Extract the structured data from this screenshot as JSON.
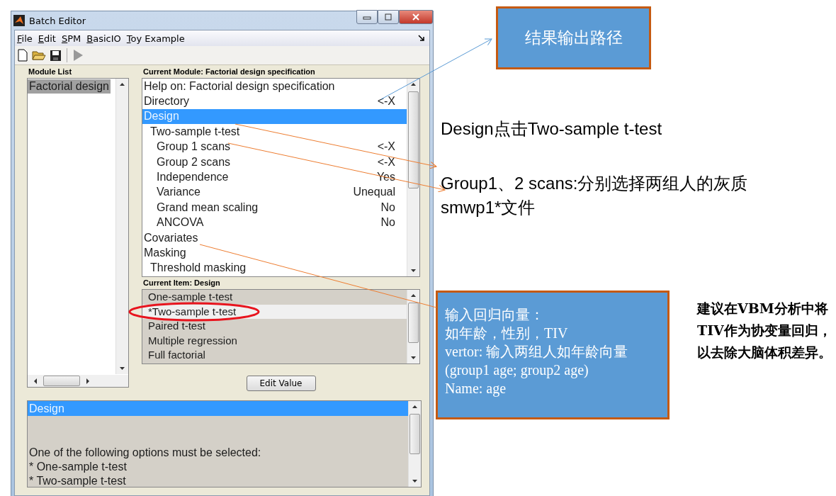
{
  "window": {
    "title": "Batch Editor"
  },
  "menu": [
    {
      "label": "File"
    },
    {
      "label": "Edit"
    },
    {
      "label": "SPM"
    },
    {
      "label": "BasicIO"
    },
    {
      "label": "Toy Example"
    }
  ],
  "module_list": {
    "heading": "Module List",
    "items": [
      {
        "label": "Factorial design",
        "selected": true
      }
    ]
  },
  "current_module": {
    "heading": "Current Module: Factorial design specification",
    "items": [
      {
        "label": "Help on: Factorial design specification",
        "selected": false
      },
      {
        "label": "Directory",
        "value": "<-X",
        "selected": false
      },
      {
        "label": "Design",
        "selected": true,
        "children": [
          {
            "label": "Two-sample t-test",
            "selected": false,
            "children": [
              {
                "label": "Group 1 scans",
                "value": "<-X",
                "selected": false
              },
              {
                "label": "Group 2 scans",
                "value": "<-X",
                "selected": false
              },
              {
                "label": "Independence",
                "value": "Yes",
                "selected": false
              },
              {
                "label": "Variance",
                "value": "Unequal",
                "selected": false
              },
              {
                "label": "Grand mean scaling",
                "value": "No",
                "selected": false
              },
              {
                "label": "ANCOVA",
                "value": "No",
                "selected": false
              }
            ]
          }
        ]
      },
      {
        "label": "Covariates",
        "selected": false
      },
      {
        "label": "Masking",
        "selected": false,
        "children": [
          {
            "label": "Threshold masking",
            "selected": false
          }
        ]
      }
    ]
  },
  "current_item": {
    "heading": "Current Item: Design",
    "options": [
      {
        "label": "One-sample t-test",
        "selected": false
      },
      {
        "label": "*Two-sample t-test",
        "selected": true
      },
      {
        "label": "Paired t-test",
        "selected": false
      },
      {
        "label": "Multiple regression",
        "selected": false
      },
      {
        "label": "Full factorial",
        "selected": false
      }
    ]
  },
  "edit_button": "Edit Value",
  "help": {
    "title": "Design",
    "lines": [
      "One of the following options must be selected:",
      "* One-sample t-test",
      "* Two-sample t-test"
    ]
  },
  "annotations": [
    {
      "kind": "box",
      "text": "结果输出路径"
    },
    {
      "kind": "plain",
      "text": "Design点击Two-sample t-test"
    },
    {
      "kind": "plain",
      "text": "Group1、2 scans:分别选择两组人的灰质smwp1*文件"
    },
    {
      "kind": "box",
      "lines": [
        "输入回归向量：",
        "如年龄，性别，TIV",
        " vertor: 输入两组人如年龄向量(group1 age; group2 age)",
        "Name: age"
      ]
    },
    {
      "kind": "note",
      "text": "建议在VBM分析中将TIV作为协变量回归，以去除大脑体积差异。"
    }
  ]
}
